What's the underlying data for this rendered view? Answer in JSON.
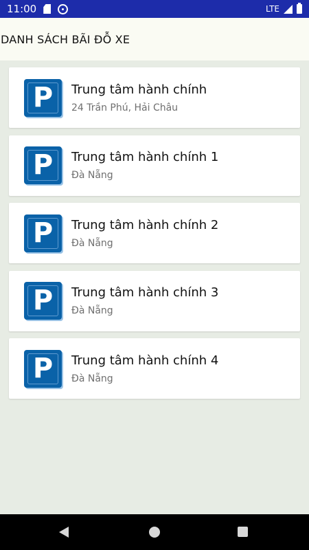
{
  "status_bar": {
    "time": "11:00",
    "network": "LTE"
  },
  "app_bar": {
    "title": "DANH SÁCH BÃI ĐỖ XE"
  },
  "parking_lots": [
    {
      "name": "Trung tâm hành chính",
      "address": "24 Trần Phú, Hải Châu",
      "icon": "parking-icon"
    },
    {
      "name": "Trung tâm hành chính 1",
      "address": "Đà Nẵng",
      "icon": "parking-icon"
    },
    {
      "name": "Trung tâm hành chính 2",
      "address": "Đà Nẵng",
      "icon": "parking-icon"
    },
    {
      "name": "Trung tâm hành chính 3",
      "address": "Đà Nẵng",
      "icon": "parking-icon"
    },
    {
      "name": "Trung tâm hành chính 4",
      "address": "Đà Nẵng",
      "icon": "parking-icon"
    }
  ],
  "icon_letter": "P",
  "colors": {
    "status_bar": "#1d2caa",
    "app_bar": "#fafbf3",
    "background": "#e7ece4",
    "parking_blue": "#0a62a8"
  }
}
